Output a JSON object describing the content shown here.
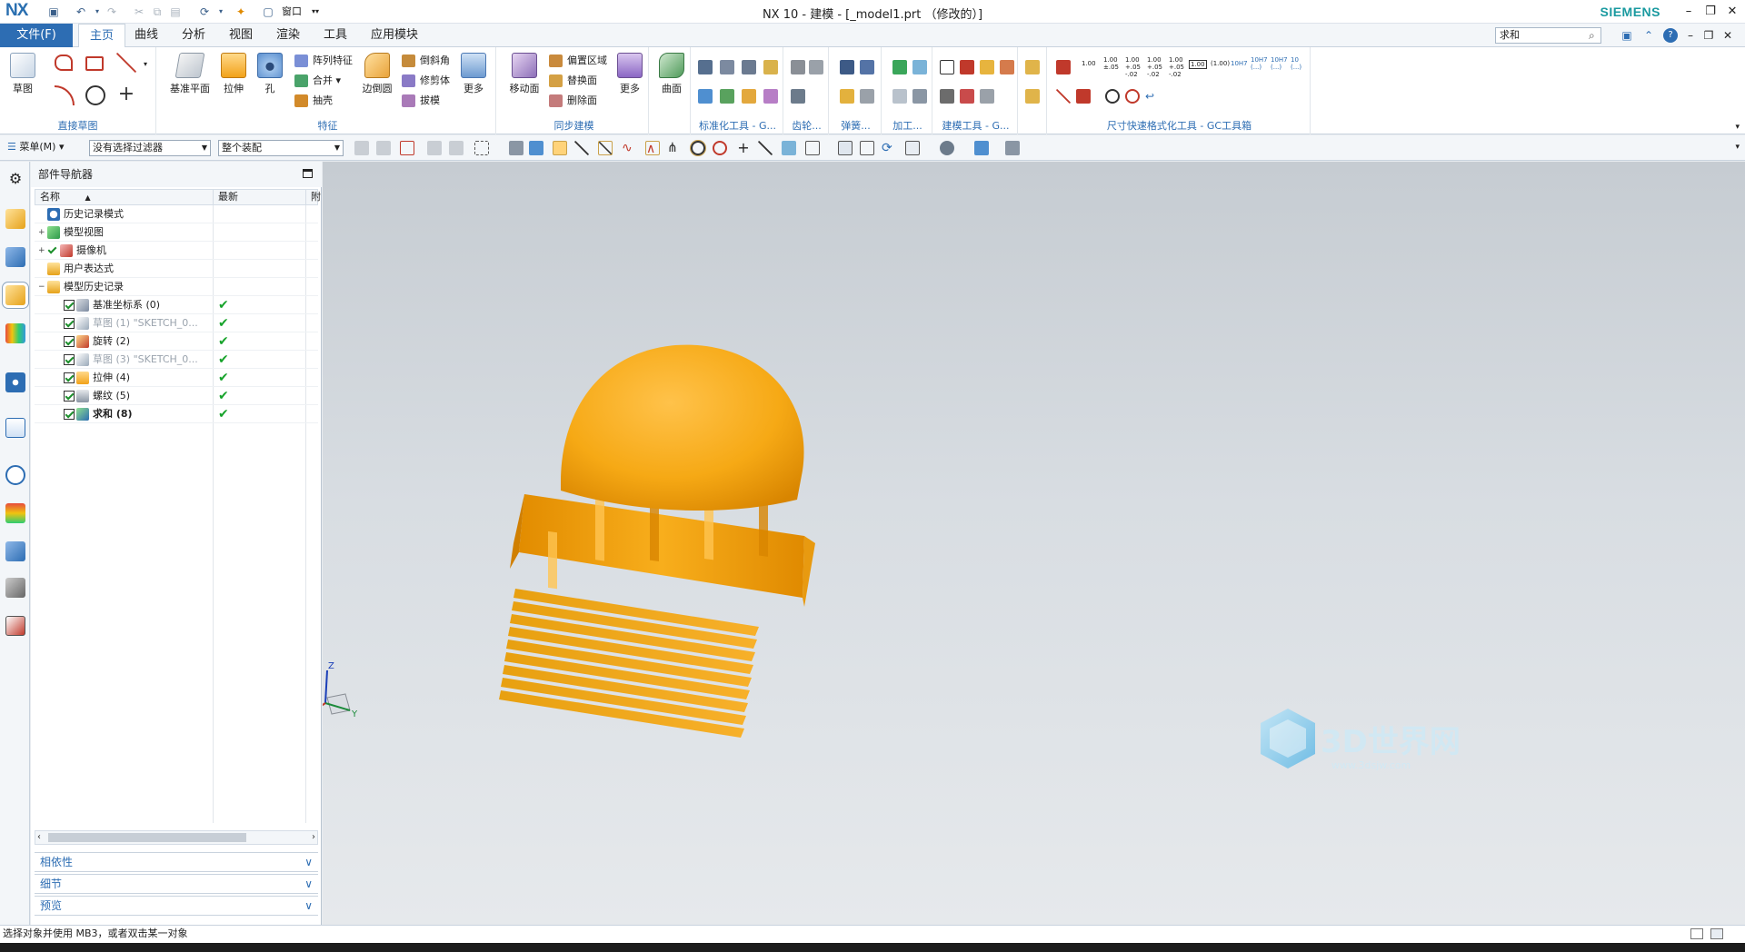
{
  "app": {
    "logo": "NX",
    "title": "NX 10 - 建模 - [_model1.prt （修改的）]",
    "brand": "SIEMENS"
  },
  "quick_access": {
    "window_label": "窗口"
  },
  "menu": {
    "file": "文件(F)",
    "tabs": [
      "主页",
      "曲线",
      "分析",
      "视图",
      "渲染",
      "工具",
      "应用模块"
    ],
    "search_value": "求和"
  },
  "ribbon": {
    "groups": {
      "direct_sketch": "直接草图",
      "feature": "特征",
      "sync_modeling": "同步建模",
      "standard_tools": "标准化工具 - G...",
      "gear": "齿轮...",
      "spring": "弹簧...",
      "machining": "加工...",
      "build_tools": "建模工具 - G...",
      "dim_tools": "尺寸快速格式化工具 - GC工具箱"
    },
    "buttons": {
      "sketch": "草图",
      "datum_plane": "基准平面",
      "extrude": "拉伸",
      "hole": "孔",
      "pattern_feature": "阵列特征",
      "unite": "合并",
      "shell": "抽壳",
      "edge_blend": "边倒圆",
      "chamfer": "倒斜角",
      "trim_body": "修剪体",
      "draft": "拔模",
      "more1": "更多",
      "move_face": "移动面",
      "offset_region": "偏置区域",
      "replace_face": "替换面",
      "delete_face": "删除面",
      "more2": "更多",
      "surface": "曲面"
    },
    "dim_values": [
      "1.00",
      "1.00 ±.05",
      "1.00 +.05 -.02",
      "1.00 +.05 -.02",
      "1.00 +.05 -.02",
      "1.00",
      "(1.00)",
      "10H7",
      "10H7 (...)",
      "10H7 (...)",
      "10 (...)"
    ]
  },
  "toolbar2": {
    "menu_label": "菜单(M)",
    "filter_value": "没有选择过滤器",
    "assembly_value": "整个装配"
  },
  "navigator": {
    "title": "部件导航器",
    "columns": [
      "名称",
      "最新",
      "附"
    ],
    "rows": [
      {
        "label": "历史记录模式",
        "indent": 1,
        "type": "clock",
        "status": ""
      },
      {
        "label": "模型视图",
        "indent": 1,
        "type": "views",
        "expander": "+",
        "status": ""
      },
      {
        "label": "摄像机",
        "indent": 1,
        "type": "camera",
        "expander": "+",
        "status": ""
      },
      {
        "label": "用户表达式",
        "indent": 1,
        "type": "folder",
        "status": ""
      },
      {
        "label": "模型历史记录",
        "indent": 1,
        "type": "folder",
        "expander": "−",
        "status": ""
      },
      {
        "label": "基准坐标系 (0)",
        "indent": 2,
        "type": "csys",
        "status": "✔",
        "dim": false
      },
      {
        "label": "草图 (1) \"SKETCH_0...",
        "indent": 2,
        "type": "sketch",
        "status": "✔",
        "dim": true
      },
      {
        "label": "旋转 (2)",
        "indent": 2,
        "type": "revolve",
        "status": "✔",
        "dim": false
      },
      {
        "label": "草图 (3) \"SKETCH_0...",
        "indent": 2,
        "type": "sketch",
        "status": "✔",
        "dim": true
      },
      {
        "label": "拉伸 (4)",
        "indent": 2,
        "type": "extrude",
        "status": "✔",
        "dim": false
      },
      {
        "label": "螺纹 (5)",
        "indent": 2,
        "type": "thread",
        "status": "✔",
        "dim": false
      },
      {
        "label": "求和 (8)",
        "indent": 2,
        "type": "unite",
        "status": "✔",
        "dim": false,
        "bold": true
      }
    ],
    "panels": [
      "相依性",
      "细节",
      "预览"
    ]
  },
  "viewport": {
    "triad": {
      "z": "Z",
      "y": "Y"
    },
    "watermark": "3D世界网",
    "watermark_sub": "www.3dsjw.com",
    "model_color": "#f6a915"
  },
  "status": {
    "message": "选择对象并使用 MB3，或者双击某一对象"
  }
}
